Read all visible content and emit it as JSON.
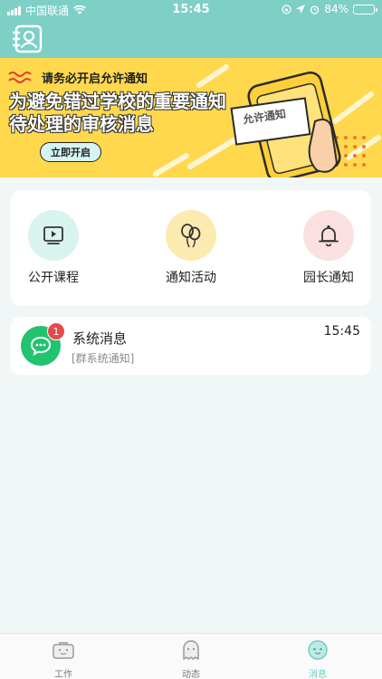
{
  "status_bar": {
    "carrier": "中国联通",
    "time": "15:45",
    "battery_percent": 84,
    "battery_text": "84%"
  },
  "banner": {
    "notice": "请务必开启允许通知",
    "headline_line1": "为避免错过学校的重要通知",
    "headline_line2": "待处理的审核消息",
    "button_label": "立即开启",
    "card_text": "允许通知"
  },
  "features": [
    {
      "label": "公开课程",
      "icon": "video-play-icon",
      "bg": "#d9f3ee"
    },
    {
      "label": "通知活动",
      "icon": "balloons-icon",
      "bg": "#fcebb0"
    },
    {
      "label": "园长通知",
      "icon": "bell-icon",
      "bg": "#fbe0e2"
    }
  ],
  "messages": [
    {
      "title": "系统消息",
      "subtitle": "[群系统通知]",
      "time": "15:45",
      "unread": "1",
      "icon": "chat-bubble-icon"
    }
  ],
  "tabs": [
    {
      "label": "工作",
      "icon": "briefcase-icon",
      "active": false
    },
    {
      "label": "动态",
      "icon": "ghost-icon",
      "active": false
    },
    {
      "label": "消息",
      "icon": "message-face-icon",
      "active": true
    }
  ],
  "colors": {
    "header": "#7ecfc6",
    "banner": "#ffd84d",
    "accent_green": "#21c36f",
    "badge_red": "#e54a4a",
    "active_tab": "#6ccfc4"
  }
}
